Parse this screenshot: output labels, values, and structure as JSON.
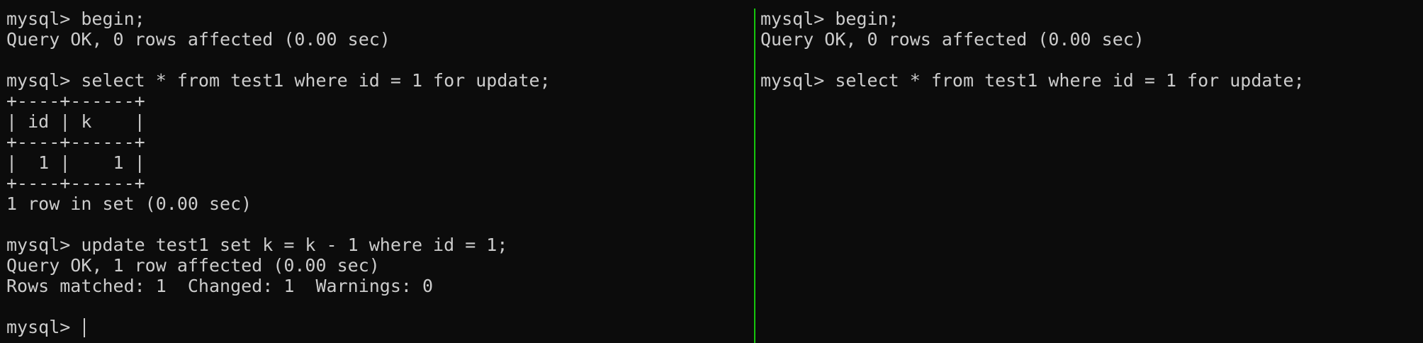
{
  "colors": {
    "background": "#0c0c0c",
    "foreground": "#cccccc",
    "active_pane_divider": "#16c60c"
  },
  "left_pane": {
    "lines": [
      "mysql> begin;",
      "Query OK, 0 rows affected (0.00 sec)",
      "",
      "mysql> select * from test1 where id = 1 for update;",
      "+----+------+",
      "| id | k    |",
      "+----+------+",
      "|  1 |    1 |",
      "+----+------+",
      "1 row in set (0.00 sec)",
      "",
      "mysql> update test1 set k = k - 1 where id = 1;",
      "Query OK, 1 row affected (0.00 sec)",
      "Rows matched: 1  Changed: 1  Warnings: 0",
      ""
    ],
    "prompt": "mysql> "
  },
  "right_pane": {
    "lines": [
      "mysql> begin;",
      "Query OK, 0 rows affected (0.00 sec)",
      "",
      "mysql> select * from test1 where id = 1 for update;"
    ]
  }
}
